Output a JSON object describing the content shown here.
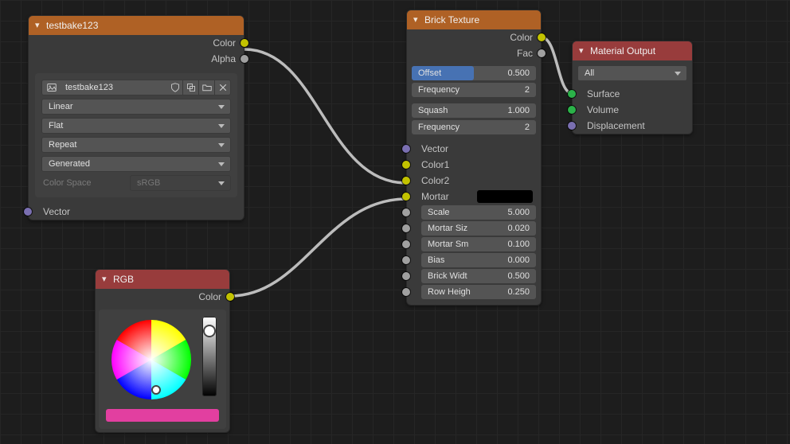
{
  "nodes": {
    "image": {
      "title": "testbake123",
      "outputs": {
        "color": "Color",
        "alpha": "Alpha"
      },
      "image_name": "testbake123",
      "interp": "Linear",
      "projection": "Flat",
      "extension": "Repeat",
      "tex_coord": "Generated",
      "color_space_label": "Color Space",
      "color_space_value": "sRGB",
      "vector_input": "Vector"
    },
    "rgb": {
      "title": "RGB",
      "output": "Color",
      "swatch_color": "#e23fa0",
      "value_slider_pos": 0.18
    },
    "brick": {
      "title": "Brick Texture",
      "outputs": {
        "color": "Color",
        "fac": "Fac"
      },
      "offset": {
        "label": "Offset",
        "value": "0.500",
        "fill": 0.5
      },
      "offset_freq": {
        "label": "Frequency",
        "value": "2"
      },
      "squash": {
        "label": "Squash",
        "value": "1.000"
      },
      "squash_freq": {
        "label": "Frequency",
        "value": "2"
      },
      "inputs": {
        "vector": "Vector",
        "color1": "Color1",
        "color2": "Color2",
        "mortar": "Mortar"
      },
      "mortar_swatch": "#000000",
      "sliders": [
        {
          "label": "Scale",
          "value": "5.000"
        },
        {
          "label": "Mortar Siz",
          "value": "0.020"
        },
        {
          "label": "Mortar Sm",
          "value": "0.100"
        },
        {
          "label": "Bias",
          "value": "0.000"
        },
        {
          "label": "Brick Widt",
          "value": "0.500"
        },
        {
          "label": "Row Heigh",
          "value": "0.250"
        }
      ]
    },
    "output": {
      "title": "Material Output",
      "target": "All",
      "inputs": {
        "surface": "Surface",
        "volume": "Volume",
        "displacement": "Displacement"
      }
    }
  }
}
